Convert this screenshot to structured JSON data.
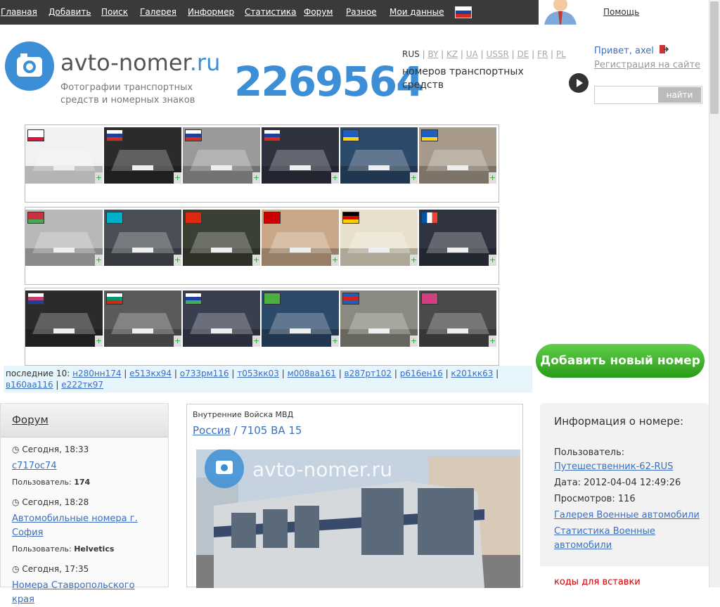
{
  "nav": {
    "items": [
      "Главная",
      "Добавить",
      "Поиск",
      "Галерея",
      "Информер",
      "Статистика",
      "Форум",
      "Разное",
      "Мои данные"
    ],
    "help": "Помощь"
  },
  "logo": {
    "name_main": "avto-nomer",
    "name_tld": ".ru",
    "subtitle": "Фотографии транспортных средств и номерных знаков"
  },
  "counter": {
    "value": "2269564",
    "desc": "номеров транспортных средств"
  },
  "langs": {
    "current": "RUS",
    "others": [
      "BY",
      "KZ",
      "UA",
      "USSR",
      "DE",
      "FR",
      "PL"
    ]
  },
  "user": {
    "greeting": "Привет, axel",
    "register": "Регистрация на сайте"
  },
  "search": {
    "button": "найти",
    "placeholder": ""
  },
  "galleries": [
    {
      "flags": [
        "PL",
        "RU",
        "RU",
        "RU",
        "UA",
        "UA"
      ]
    },
    {
      "flags": [
        "BY",
        "KZ",
        "CN",
        "SU",
        "DE",
        "FR"
      ]
    },
    {
      "flags": [
        "RU-REG",
        "BG",
        "RU-REG2",
        "RU-REG3",
        "RU-REG4",
        "RU-REG5"
      ]
    }
  ],
  "last10": {
    "label": "последние 10:",
    "plates": [
      "н280нн174",
      "е513кх94",
      "о733рм116",
      "т053кк03",
      "м008ва161",
      "в287рт102",
      "р616ен16",
      "к201кк63",
      "в160аа116",
      "е222тк97"
    ]
  },
  "add_button": "Добавить новый номер",
  "forum": {
    "title": "Форум",
    "posts": [
      {
        "time": "Сегодня, 18:33",
        "title": "с717ос74",
        "user_label": "Пользователь:",
        "user": "174"
      },
      {
        "time": "Сегодня, 18:28",
        "title": "Автомобильные номера г. София",
        "user_label": "Пользователь:",
        "user": "Helvetics"
      },
      {
        "time": "Сегодня, 17:35",
        "title": "Номера Ставропольского края",
        "user_label": "",
        "user": ""
      }
    ]
  },
  "photo": {
    "category": "Внутренние Войска МВД",
    "country": "Россия",
    "separator": "/",
    "plate": "7105 ВА 15",
    "watermark": "avto-nomer.ru"
  },
  "info": {
    "title": "Информация о номере:",
    "user_label": "Пользователь:",
    "user": "Путешественник-62-RUS",
    "date": "Дата: 2012-04-04 12:49:26",
    "views": "Просмотров: 116",
    "gallery_link": "Галерея Военные автомобили",
    "stats_link": "Статистика Военные автомобили",
    "codes": "коды для вставки"
  },
  "colors": {
    "accent": "#3c8fd6",
    "link": "#3c6fc0",
    "topbar": "#3a3a3a",
    "green": "#2a9a1a"
  }
}
